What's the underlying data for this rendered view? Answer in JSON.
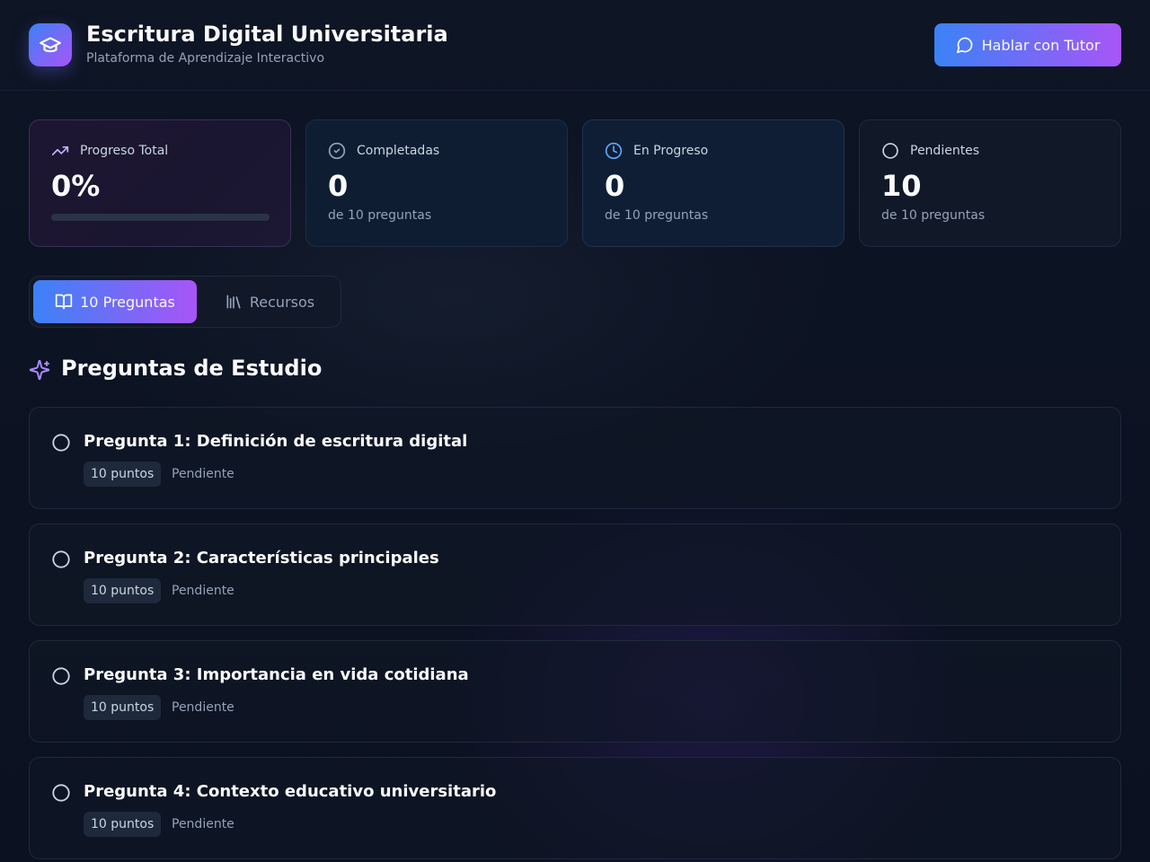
{
  "header": {
    "title": "Escritura Digital Universitaria",
    "subtitle": "Plataforma de Aprendizaje Interactivo",
    "logo_icon": "graduation-cap-icon",
    "tutor_button_label": "Hablar con Tutor",
    "tutor_button_icon": "chat-bubble-icon"
  },
  "stats": [
    {
      "label": "Progreso Total",
      "value": "0%",
      "icon": "trending-up-icon",
      "progress": 0
    },
    {
      "label": "Completadas",
      "value": "0",
      "sub": "de 10 preguntas",
      "icon": "check-circle-icon"
    },
    {
      "label": "En Progreso",
      "value": "0",
      "sub": "de 10 preguntas",
      "icon": "clock-icon"
    },
    {
      "label": "Pendientes",
      "value": "10",
      "sub": "de 10 preguntas",
      "icon": "circle-icon"
    }
  ],
  "tabs": [
    {
      "label": "10 Preguntas",
      "icon": "book-open-icon",
      "active": true
    },
    {
      "label": "Recursos",
      "icon": "library-icon",
      "active": false
    }
  ],
  "section": {
    "title": "Preguntas de Estudio",
    "icon": "sparkles-icon"
  },
  "questions": [
    {
      "title": "Pregunta 1: Definición de escritura digital",
      "points": "10 puntos",
      "status": "Pendiente"
    },
    {
      "title": "Pregunta 2: Características principales",
      "points": "10 puntos",
      "status": "Pendiente"
    },
    {
      "title": "Pregunta 3: Importancia en vida cotidiana",
      "points": "10 puntos",
      "status": "Pendiente"
    },
    {
      "title": "Pregunta 4: Contexto educativo universitario",
      "points": "10 puntos",
      "status": "Pendiente"
    }
  ],
  "colors": {
    "accent_start": "#3b82f6",
    "accent_end": "#a855f7",
    "background": "#0c1221"
  }
}
